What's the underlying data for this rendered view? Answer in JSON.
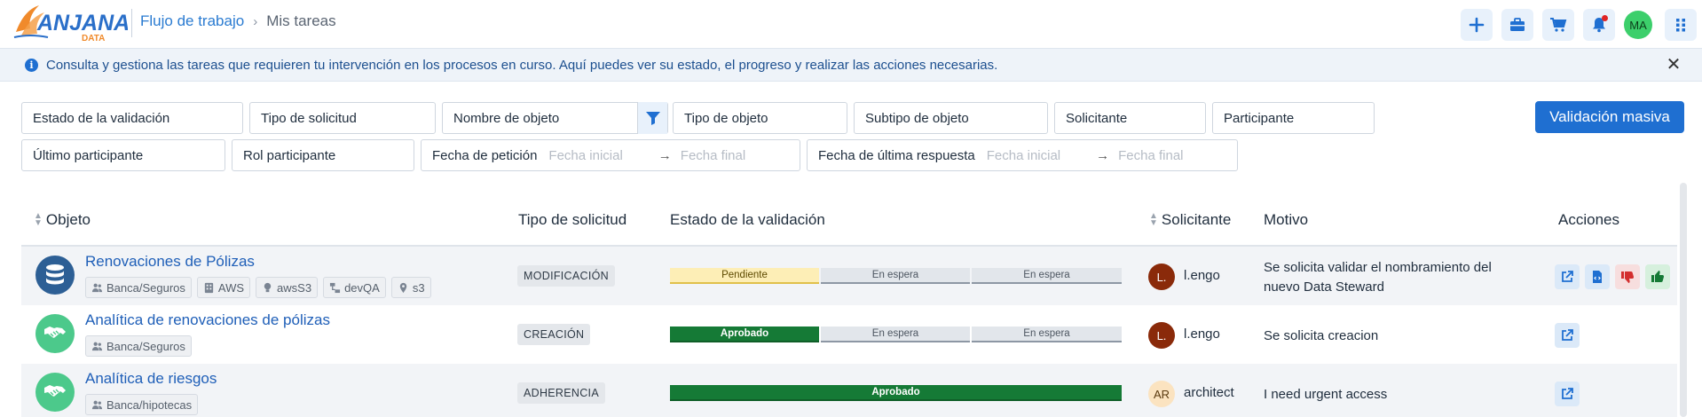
{
  "header": {
    "logo_text": "ANJANA",
    "logo_sub": "DATA",
    "breadcrumb_parent": "Flujo de trabajo",
    "breadcrumb_separator": "›",
    "breadcrumb_current": "Mis tareas",
    "avatar_initials": "MA",
    "icons": [
      "plus-icon",
      "briefcase-icon",
      "cart-icon",
      "bell-icon",
      "apps-grid-icon"
    ]
  },
  "infobar": {
    "text": "Consulta y gestiona las tareas que requieren tu intervención en los procesos en curso. Aquí puedes ver su estado, el progreso y realizar las acciones necesarias.",
    "close": "✕"
  },
  "filters": {
    "estado": "Estado de la validación",
    "tipo_solicitud": "Tipo de solicitud",
    "nombre_objeto": "Nombre de objeto",
    "tipo_objeto": "Tipo de objeto",
    "subtipo_objeto": "Subtipo de objeto",
    "solicitante": "Solicitante",
    "participante": "Participante",
    "ultimo_participante": "Último participante",
    "rol_participante": "Rol participante",
    "fecha_peticion": "Fecha de petición",
    "fecha_ultima": "Fecha de última respuesta",
    "fecha_inicial": "Fecha inicial",
    "fecha_final": "Fecha final",
    "arrow": "→",
    "mass_validation": "Validación masiva"
  },
  "table": {
    "columns": {
      "objeto": "Objeto",
      "tipo": "Tipo de solicitud",
      "estado": "Estado de la validación",
      "solicitante": "Solicitante",
      "motivo": "Motivo",
      "acciones": "Acciones"
    },
    "rows": [
      {
        "title": "Renovaciones de Pólizas",
        "icon": "database-icon",
        "tags": [
          "Banca/Seguros",
          "AWS",
          "awsS3",
          "devQA",
          "s3"
        ],
        "type": "MODIFICACIÓN",
        "status": [
          "Pendiente",
          "En espera",
          "En espera"
        ],
        "requester_initial": "L.",
        "requester": "l.engo",
        "reason": "Se solicita validar el nombramiento del nuevo Data Steward"
      },
      {
        "title": "Analítica de renovaciones de pólizas",
        "icon": "handshake-icon",
        "tags": [
          "Banca/Seguros"
        ],
        "type": "CREACIÓN",
        "status": [
          "Aprobado",
          "En espera",
          "En espera"
        ],
        "requester_initial": "L.",
        "requester": "l.engo",
        "reason": "Se solicita creacion"
      },
      {
        "title": "Analítica de riesgos",
        "icon": "handshake-icon",
        "tags": [
          "Banca/hipotecas"
        ],
        "type": "ADHERENCIA",
        "status": [
          "Aprobado"
        ],
        "requester_initial": "AR",
        "requester": "architect",
        "reason": "I need urgent access"
      }
    ]
  },
  "colors": {
    "accent": "#1f6fd1",
    "pending": "#fdeeb6",
    "approved": "#157a36",
    "waiting": "#e2e6eb"
  }
}
